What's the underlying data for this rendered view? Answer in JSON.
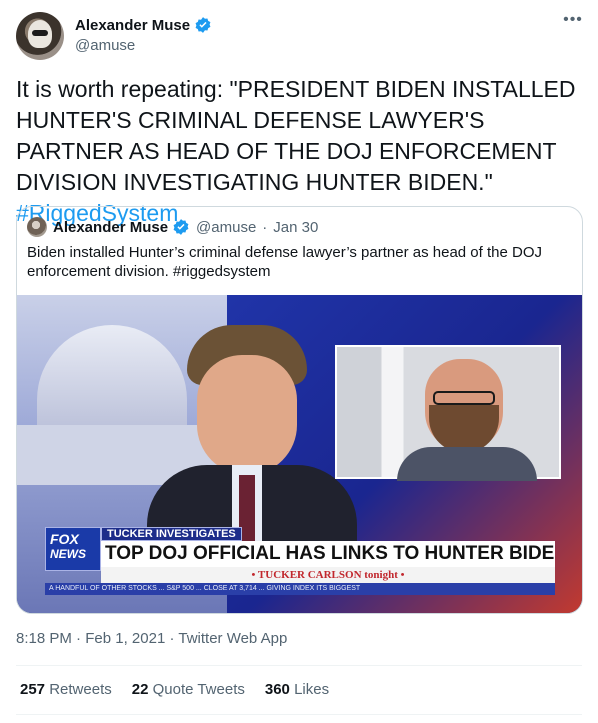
{
  "author": {
    "name": "Alexander Muse",
    "handle": "@amuse",
    "avatar": "profile-photo"
  },
  "tweet": {
    "text": "It is worth repeating: \"PRESIDENT BIDEN INSTALLED HUNTER'S CRIMINAL DEFENSE LAWYER'S PARTNER AS HEAD OF THE DOJ ENFORCEMENT DIVISION INVESTIGATING HUNTER BIDEN.\"",
    "hashtag": "#RiggedSystem"
  },
  "quoted": {
    "name": "Alexander Muse",
    "handle": "@amuse",
    "separator": "·",
    "date": "Jan 30",
    "text": "Biden installed Hunter’s criminal defense lawyer’s partner as head of the DOJ enforcement division. #riggedsystem",
    "media": {
      "banner_label": "TUCKER INVESTIGATES",
      "network_line1": "FOX",
      "network_line2": "NEWS",
      "headline": "TOP DOJ OFFICIAL HAS LINKS TO HUNTER BIDEN'S ATTY",
      "show": "• TUCKER CARLSON tonight •",
      "ticker": "A HANDFUL OF OTHER STOCKS ... S&P 500 ... CLOSE AT 3,714 ... GIVING INDEX ITS BIGGEST"
    }
  },
  "meta": {
    "time": "8:18 PM",
    "separator": "·",
    "date": "Feb 1, 2021",
    "source": "Twitter Web App"
  },
  "stats": {
    "retweets_count": "257",
    "retweets_label": "Retweets",
    "quotes_count": "22",
    "quotes_label": "Quote Tweets",
    "likes_count": "360",
    "likes_label": "Likes"
  },
  "icons": {
    "verified": "verified-badge-icon",
    "more": "more-options-icon"
  },
  "colors": {
    "link": "#1d9bf0",
    "secondary_text": "#536471",
    "border": "#cfd9de"
  }
}
